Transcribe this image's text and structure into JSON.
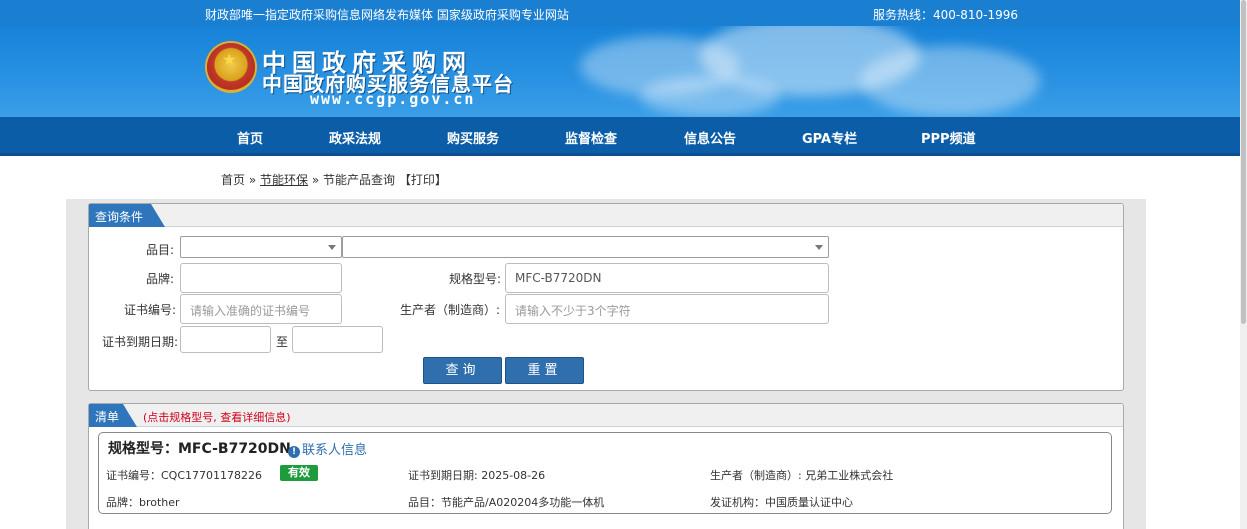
{
  "topbar": {
    "slogan": "财政部唯一指定政府采购信息网络发布媒体 国家级政府采购专业网站",
    "hotline": "服务热线：400-810-1996"
  },
  "banner": {
    "title": "中国政府采购网",
    "subtitle": "中国政府购买服务信息平台",
    "url": "www.ccgp.gov.cn"
  },
  "nav": {
    "items": [
      "首页",
      "政采法规",
      "购买服务",
      "监督检查",
      "信息公告",
      "GPA专栏",
      "PPP频道"
    ]
  },
  "breadcrumb": {
    "home": "首页",
    "sep1": " » ",
    "section": "节能环保",
    "sep2": " » ",
    "current": "节能产品查询",
    "print": "【打印】"
  },
  "query": {
    "tab": "查询条件",
    "category_label": "品目:",
    "category_value": "",
    "subcategory_value": "",
    "brand_label": "品牌:",
    "brand_value": "",
    "model_label": "规格型号:",
    "model_value": "MFC-B7720DN",
    "cert_label": "证书编号:",
    "cert_placeholder": "请输入准确的证书编号",
    "maker_label": "生产者（制造商）:",
    "maker_placeholder": "请输入不少于3个字符",
    "expire_label": "证书到期日期:",
    "to_label": "至",
    "search_btn": "查询",
    "reset_btn": "重置"
  },
  "list": {
    "tab": "清单",
    "hint": "(点击规格型号, 查看详细信息)",
    "item": {
      "title": "规格型号：MFC-B7720DN",
      "contact": "联系人信息",
      "cert": "证书编号：CQC17701178226",
      "status": "有效",
      "expire": "证书到期日期: 2025-08-26",
      "maker": "生产者（制造商）: 兄弟工业株式会社",
      "brand": "品牌：brother",
      "category": "品目：节能产品/A020204多功能一体机",
      "issuer": "发证机构：中国质量认证中心"
    }
  },
  "colors": {
    "header_blue": "#1a7fd1",
    "nav_blue": "#0b5da8",
    "tab_blue": "#2f75bb",
    "status_green": "#1e9b3d",
    "hint_red": "#d0021b"
  }
}
